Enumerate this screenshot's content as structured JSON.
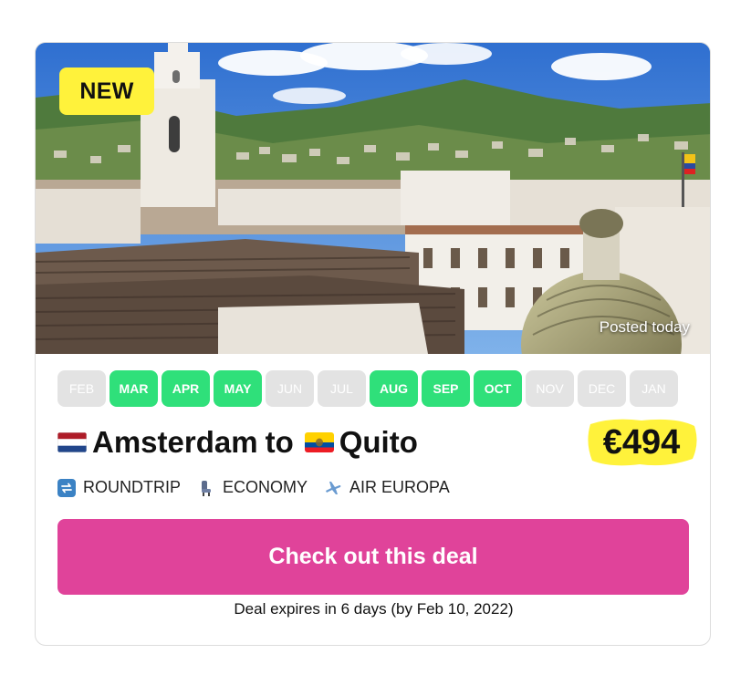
{
  "deal": {
    "badge": "NEW",
    "posted": "Posted today",
    "months": [
      {
        "label": "FEB",
        "active": false
      },
      {
        "label": "MAR",
        "active": true
      },
      {
        "label": "APR",
        "active": true
      },
      {
        "label": "MAY",
        "active": true
      },
      {
        "label": "JUN",
        "active": false
      },
      {
        "label": "JUL",
        "active": false
      },
      {
        "label": "AUG",
        "active": true
      },
      {
        "label": "SEP",
        "active": true
      },
      {
        "label": "OCT",
        "active": true
      },
      {
        "label": "NOV",
        "active": false
      },
      {
        "label": "DEC",
        "active": false
      },
      {
        "label": "JAN",
        "active": false
      }
    ],
    "origin": "Amsterdam",
    "connector": "to",
    "destination": "Quito",
    "price": "€494",
    "meta": {
      "trip_type": "ROUNDTRIP",
      "cabin": "ECONOMY",
      "airline": "AIR EUROPA"
    },
    "cta_label": "Check out this deal",
    "expires": "Deal expires in 6 days (by Feb 10, 2022)"
  },
  "icons": {
    "origin_flag": "netherlands-flag-icon",
    "destination_flag": "ecuador-flag-icon",
    "trip_type": "roundtrip-icon",
    "cabin": "seat-icon",
    "airline": "airplane-icon"
  },
  "colors": {
    "month_active": "#2fe07a",
    "month_inactive": "#e3e3e3",
    "badge": "#fff23b",
    "price_highlight": "#fff23b",
    "cta": "#e0439a"
  }
}
